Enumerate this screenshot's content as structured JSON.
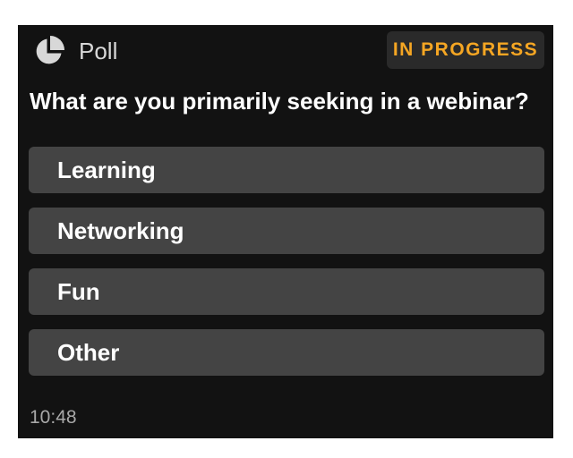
{
  "header": {
    "icon": "pie-chart-icon",
    "title": "Poll",
    "status": "IN PROGRESS"
  },
  "question": "What are you primarily seeking in a webinar?",
  "options": [
    {
      "label": "Learning"
    },
    {
      "label": "Networking"
    },
    {
      "label": "Fun"
    },
    {
      "label": "Other"
    }
  ],
  "timestamp": "10:48",
  "colors": {
    "card_background": "#121212",
    "option_background": "#444444",
    "status_accent": "#f5a623",
    "badge_background": "#2a2a2a"
  }
}
